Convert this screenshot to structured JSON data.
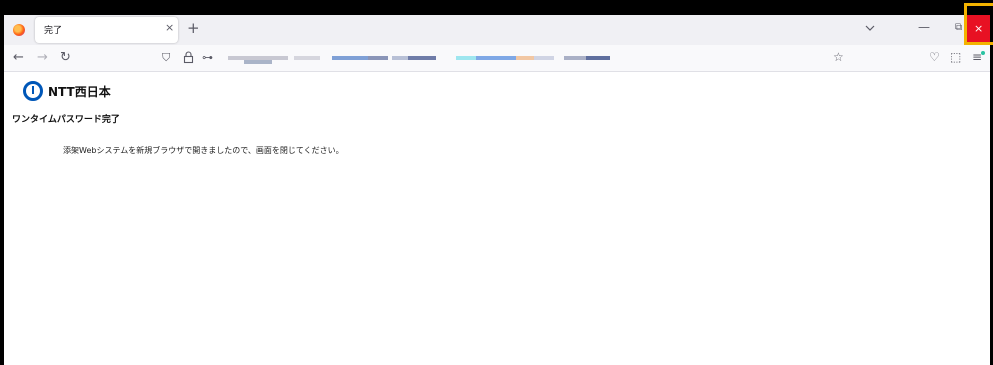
{
  "browser": {
    "tab": {
      "title": "完了",
      "close_icon": "×"
    },
    "new_tab_icon": "+",
    "window_controls": {
      "minimize": "—",
      "restore": "⧉",
      "close": "×"
    },
    "nav": {
      "back": "←",
      "forward": "→",
      "reload": "↻"
    },
    "url_icons": {
      "shield": "⛉",
      "lock": "🔒",
      "key": "⊶"
    },
    "right_icons": {
      "bookmark": "☆",
      "pocket": "♡",
      "extensions": "⬚",
      "menu": "≡"
    },
    "url_redacted": true,
    "accent_colors": {
      "close_button": "#e81123",
      "highlight": "#f3b300"
    }
  },
  "page": {
    "logo_text": "NTT西日本",
    "heading": "ワンタイムパスワード完了",
    "message": "添架Webシステムを新規ブラウザで開きましたので、画面を閉じてください。"
  }
}
